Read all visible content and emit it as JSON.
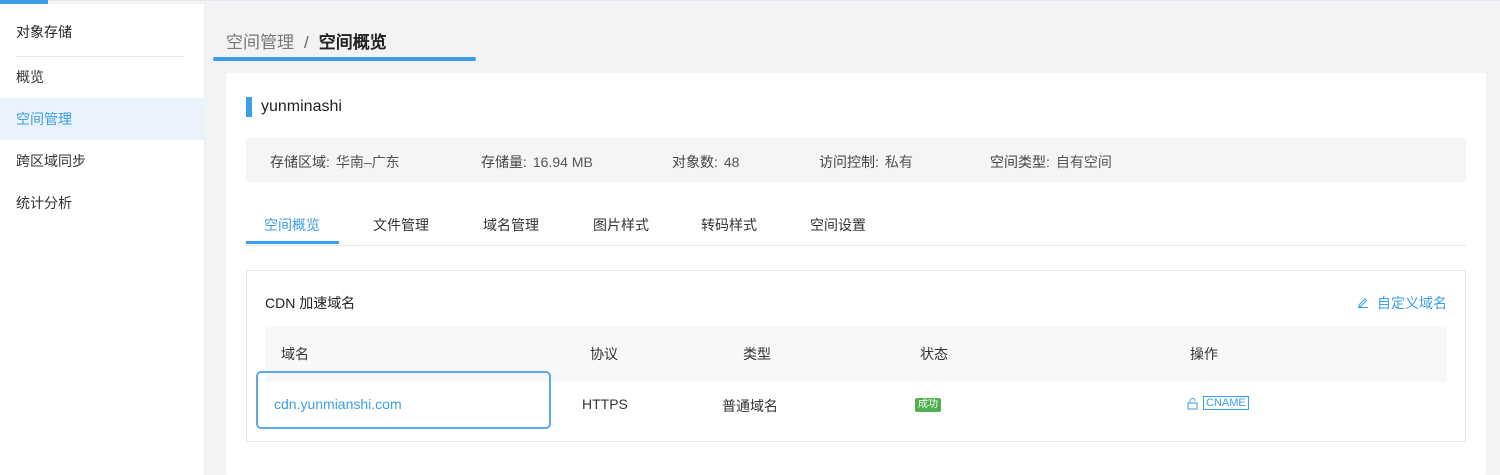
{
  "sidebar": {
    "title": "对象存储",
    "items": [
      {
        "label": "概览",
        "active": false
      },
      {
        "label": "空间管理",
        "active": true
      },
      {
        "label": "跨区域同步",
        "active": false
      },
      {
        "label": "统计分析",
        "active": false
      }
    ]
  },
  "breadcrumb": {
    "parent": "空间管理",
    "separator": "/",
    "current": "空间概览"
  },
  "bucket": {
    "name": "yunminashi"
  },
  "info": {
    "region_label": "存储区域:",
    "region_value": "华南–广东",
    "storage_label": "存储量:",
    "storage_value": "16.94 MB",
    "objects_label": "对象数:",
    "objects_value": "48",
    "access_label": "访问控制:",
    "access_value": "私有",
    "type_label": "空间类型:",
    "type_value": "自有空间"
  },
  "tabs": [
    {
      "label": "空间概览",
      "active": true
    },
    {
      "label": "文件管理",
      "active": false
    },
    {
      "label": "域名管理",
      "active": false
    },
    {
      "label": "图片样式",
      "active": false
    },
    {
      "label": "转码样式",
      "active": false
    },
    {
      "label": "空间设置",
      "active": false
    }
  ],
  "cdn": {
    "title": "CDN 加速域名",
    "custom_domain_label": "自定义域名",
    "columns": [
      "域名",
      "协议",
      "类型",
      "状态",
      "操作"
    ],
    "rows": [
      {
        "domain": "cdn.yunmianshi.com",
        "protocol": "HTTPS",
        "type": "普通域名",
        "status": "成功",
        "action": "CNAME"
      }
    ]
  },
  "colors": {
    "accent": "#3a9ee8",
    "success": "#4cb14c"
  },
  "icons": {
    "edit": "pencil-icon",
    "lock": "lock-icon"
  }
}
